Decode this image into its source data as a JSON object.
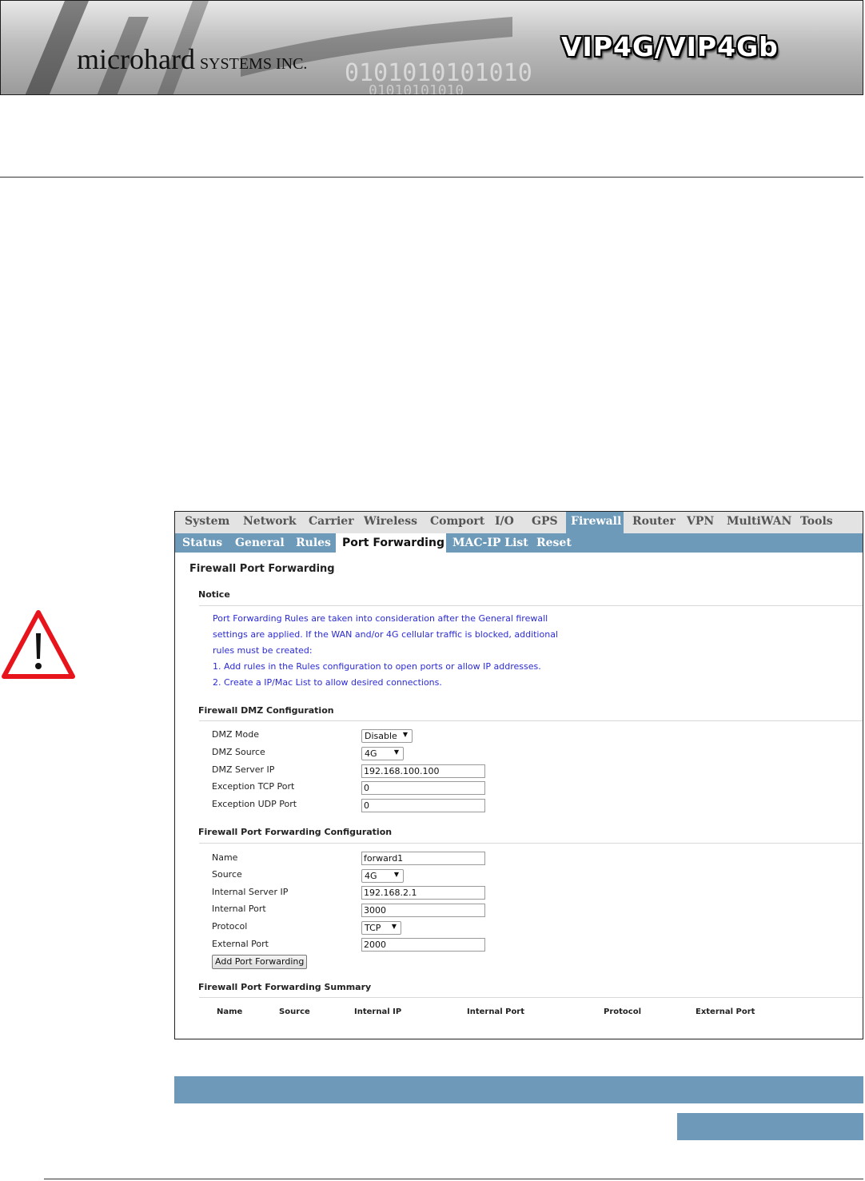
{
  "header": {
    "brand_name": "microhard",
    "brand_suffix": "SYSTEMS INC.",
    "product": "VIP4G/VIP4Gb"
  },
  "warning": {
    "icon": "warning-triangle-icon"
  },
  "screenshot": {
    "nav": {
      "top_tabs": [
        "System",
        "Network",
        "Carrier",
        "Wireless",
        "Comport",
        "I/O",
        "GPS",
        "Firewall",
        "Router",
        "VPN",
        "MultiWAN",
        "Tools"
      ],
      "active_top_tab": "Firewall",
      "sub_tabs": [
        "Status",
        "General",
        "Rules",
        "Port Forwarding",
        "MAC-IP List",
        "Reset"
      ],
      "active_sub_tab": "Port Forwarding"
    },
    "page_title": "Firewall Port Forwarding",
    "notice": {
      "heading": "Notice",
      "lines": [
        "Port Forwarding Rules are taken into consideration after the General firewall",
        "settings are applied. If the WAN and/or 4G cellular traffic is blocked, additional",
        "rules must be created:",
        "1. Add rules in the Rules configuration to open ports or allow IP addresses.",
        "2. Create a IP/Mac List to allow desired connections."
      ]
    },
    "dmz": {
      "heading": "Firewall DMZ Configuration",
      "mode_label": "DMZ Mode",
      "mode_value": "Disable",
      "source_label": "DMZ Source",
      "source_value": "4G",
      "server_ip_label": "DMZ Server IP",
      "server_ip_value": "192.168.100.100",
      "tcp_label": "Exception TCP Port",
      "tcp_value": "0",
      "udp_label": "Exception UDP Port",
      "udp_value": "0"
    },
    "forwarding": {
      "heading": "Firewall Port Forwarding Configuration",
      "name_label": "Name",
      "name_value": "forward1",
      "source_label": "Source",
      "source_value": "4G",
      "internal_ip_label": "Internal Server IP",
      "internal_ip_value": "192.168.2.1",
      "internal_port_label": "Internal Port",
      "internal_port_value": "3000",
      "protocol_label": "Protocol",
      "protocol_value": "TCP",
      "external_port_label": "External Port",
      "external_port_value": "2000",
      "add_button": "Add Port Forwarding"
    },
    "summary": {
      "heading": "Firewall Port Forwarding Summary",
      "columns": [
        "Name",
        "Source",
        "Internal IP",
        "Internal Port",
        "Protocol",
        "External Port"
      ]
    }
  },
  "colors": {
    "accent": "#6e9ab9",
    "notice_text": "#2b2bd6",
    "warning_red": "#e8141b"
  }
}
